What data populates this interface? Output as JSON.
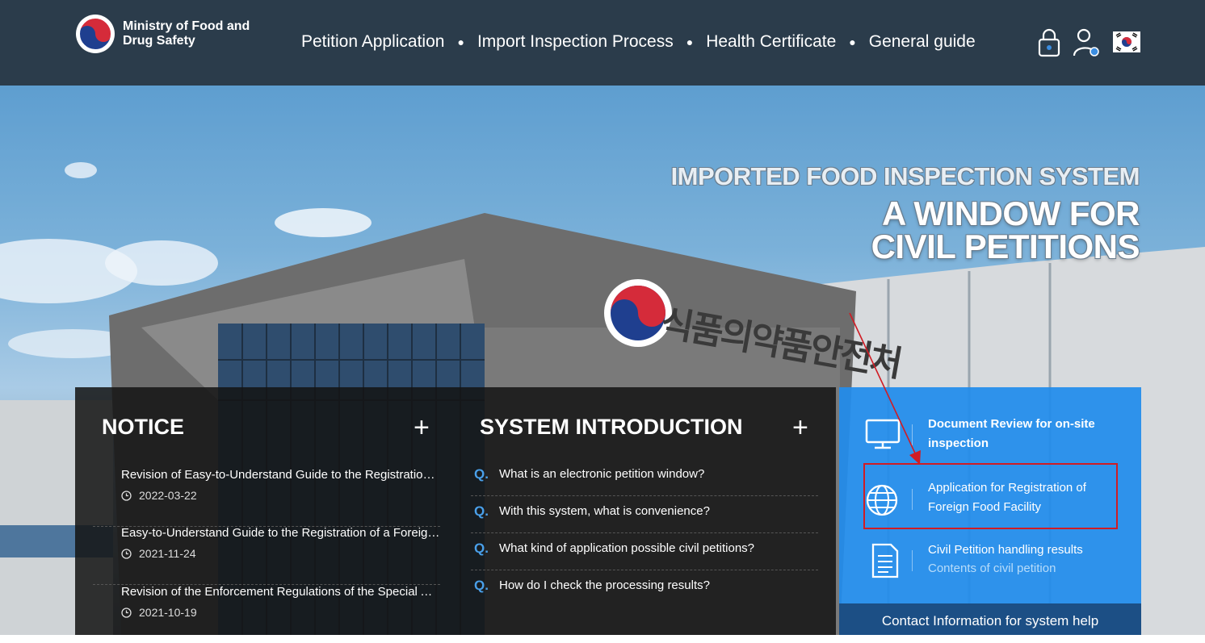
{
  "header": {
    "logo_line1": "Ministry of Food and",
    "logo_line2": "Drug Safety",
    "nav": [
      {
        "label": "Petition Application"
      },
      {
        "label": "Import Inspection Process"
      },
      {
        "label": "Health Certificate"
      },
      {
        "label": "General guide"
      }
    ],
    "icons": [
      "lock-icon",
      "user-icon",
      "korean-flag-icon"
    ]
  },
  "hero": {
    "subtitle": "IMPORTED FOOD INSPECTION SYSTEM",
    "title_line1": "A WINDOW FOR",
    "title_line2": "CIVIL PETITIONS",
    "building_sign": "식품의약품안전처"
  },
  "notice": {
    "title": "NOTICE",
    "more_label": "+",
    "items": [
      {
        "title": "Revision of Easy-to-Understand Guide to the Registration of a Foreign Food Facility",
        "date": "2022-03-22"
      },
      {
        "title": "Easy-to-Understand Guide to the Registration of a Foreign Food Facility",
        "date": "2021-11-24"
      },
      {
        "title": "Revision of the Enforcement Regulations of the Special Act on Imported Food Safety Control",
        "date": "2021-10-19"
      }
    ]
  },
  "system_intro": {
    "title": "SYSTEM INTRODUCTION",
    "more_label": "+",
    "q_marker": "Q.",
    "items": [
      {
        "text": "What is an electronic petition window?"
      },
      {
        "text": "With this system, what is convenience?"
      },
      {
        "text": "What kind of application possible civil petitions?"
      },
      {
        "text": "How do I check the processing results?"
      }
    ]
  },
  "services": {
    "items": [
      {
        "title": "Document Review for on-site inspection",
        "icon": "monitor-icon"
      },
      {
        "title": "Application for Registration of Foreign Food Facility",
        "icon": "globe-icon"
      },
      {
        "title": "Civil Petition handling results",
        "subtitle": "Contents of civil petition",
        "icon": "document-icon"
      }
    ],
    "contact_label": "Contact Information for system help"
  },
  "colors": {
    "header_bg": "#2b3c4b",
    "accent_blue": "#218cec",
    "q_blue": "#4aa0ea",
    "highlight_red": "#d01c24"
  }
}
